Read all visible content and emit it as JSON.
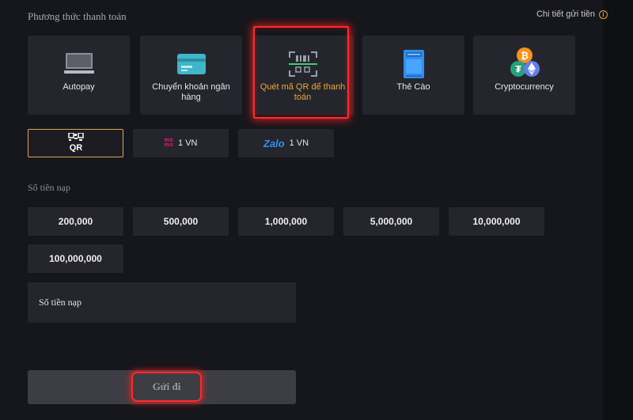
{
  "payment_methods_title": "Phương thức thanh toán",
  "details_link": "Chi tiết gửi tiền",
  "methods": [
    {
      "label": "Autopay",
      "icon": "monitor-icon"
    },
    {
      "label": "Chuyển khoản ngân hàng",
      "icon": "bank-card-icon"
    },
    {
      "label": "Quét mã QR để thanh toán",
      "icon": "qr-scan-icon",
      "active": true
    },
    {
      "label": "Thẻ Cào",
      "icon": "phone-card-icon"
    },
    {
      "label": "Cryptocurrency",
      "icon": "crypto-coins-icon"
    }
  ],
  "sub_options": [
    {
      "label": "",
      "icon": "qr-logo-icon",
      "selected": true
    },
    {
      "label": "1 VN",
      "icon": "momo-logo-icon",
      "logo_text": "mo mo"
    },
    {
      "label": "1 VN",
      "icon": "zalo-logo-icon",
      "logo_text": "Zalo"
    }
  ],
  "amount_title": "Số tiền nạp",
  "amounts": [
    "200,000",
    "500,000",
    "1,000,000",
    "5,000,000",
    "10,000,000",
    "100,000,000"
  ],
  "amount_input": {
    "placeholder": "Số tiền nạp",
    "value": ""
  },
  "submit_label": "Gửi đi",
  "colors": {
    "accent": "#f0a632",
    "highlight": "#ff2a2a",
    "panel": "#16171c",
    "tile": "#25262d"
  }
}
